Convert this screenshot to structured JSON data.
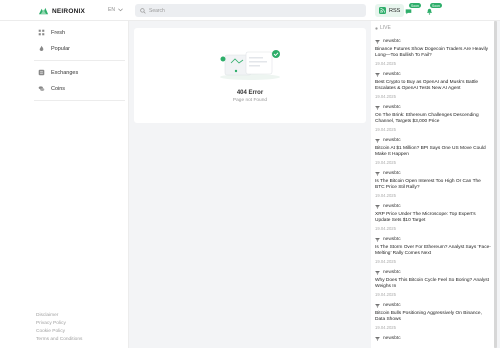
{
  "header": {
    "logo_text": "NEIRONIX",
    "language": "EN",
    "search_placeholder": "Search",
    "rss_label": "RSS",
    "icon1_badge": "Soon",
    "icon2_badge": "Soon"
  },
  "sidebar": {
    "items": [
      {
        "label": "Fresh",
        "icon": "clock-icon"
      },
      {
        "label": "Popular",
        "icon": "fire-icon"
      },
      {
        "label": "Exchanges",
        "icon": "exchange-icon"
      },
      {
        "label": "Coins",
        "icon": "coins-icon"
      }
    ],
    "footer": [
      "Disclaimer",
      "Privacy Policy",
      "Cookie Policy",
      "Terms and Conditions"
    ]
  },
  "main": {
    "error_title": "404 Error",
    "error_subtitle": "Page not Found"
  },
  "news": {
    "live_label": "LIVE",
    "items": [
      {
        "source": "newsbtc",
        "headline": "Binance Futures Show Dogecoin Traders Are Heavily Long—Too Bullish To Fail?",
        "date": "19.04.2025"
      },
      {
        "source": "newsbtc",
        "headline": "Best Crypto to Buy as OpenAI and Musk’s Battle Escalates & OpenAI Tests New AI Agent",
        "date": "19.04.2025"
      },
      {
        "source": "newsbtc",
        "headline": "On The Brink: Ethereum Challenges Descending Channel, Targets $3,000 Price",
        "date": "19.04.2025"
      },
      {
        "source": "newsbtc",
        "headline": "Bitcoin At $1 Million? BPI Says One US Move Could Make It Happen",
        "date": "19.04.2025"
      },
      {
        "source": "newsbtc",
        "headline": "Is The Bitcoin Open Interest Too High Or Can The BTC Price Stil Rally?",
        "date": "19.04.2025"
      },
      {
        "source": "newsbtc",
        "headline": "XRP Price Under The Microscope: Top Expert’s Update Sets $10 Target",
        "date": "19.04.2025"
      },
      {
        "source": "newsbtc",
        "headline": "Is The Storm Over For Ethereum? Analyst Says ‘Face-Melting’ Rally Comes Next",
        "date": "19.04.2025"
      },
      {
        "source": "newsbtc",
        "headline": "Why Does This Bitcoin Cycle Feel So Boring? Analyst Weighs In",
        "date": "19.04.2025"
      },
      {
        "source": "newsbtc",
        "headline": "Bitcoin Bulls Positioning Aggressively On Binance, Data Shows",
        "date": "19.04.2025"
      },
      {
        "source": "newsbtc",
        "headline": "",
        "date": ""
      }
    ]
  },
  "colors": {
    "accent": "#2eae6a",
    "background": "#f3f4f6"
  }
}
